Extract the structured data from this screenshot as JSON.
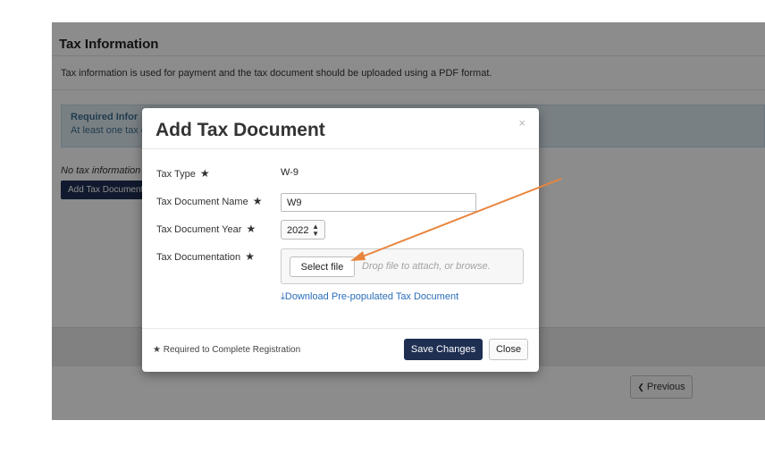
{
  "page": {
    "title": "Tax Information",
    "description": "Tax information is used for payment and the tax document should be uploaded using a PDF format.",
    "alert_title": "Required Infor",
    "alert_text": "At least one tax d",
    "no_tax_text": "No tax information",
    "add_tax_button": "Add Tax Document",
    "previous_button": "Previous",
    "previous_icon": "chevron-left-icon"
  },
  "modal": {
    "title": "Add Tax Document",
    "close_glyph": "×",
    "required_mark": "★",
    "fields": {
      "tax_type_label": "Tax Type",
      "tax_type_value": "W-9",
      "doc_name_label": "Tax Document Name",
      "doc_name_value": "W9",
      "doc_year_label": "Tax Document Year",
      "doc_year_value": "2022",
      "doc_label": "Tax Documentation"
    },
    "select_file_button": "Select file",
    "drop_hint": "Drop file to attach, or browse.",
    "download_link": "Download Pre-populated Tax Document",
    "download_icon": "download-icon",
    "footer_note": "Required to Complete Registration",
    "save_button": "Save Changes",
    "close_button": "Close"
  },
  "colors": {
    "primary_button": "#1e2f52",
    "link": "#2a6ebb",
    "annotation_arrow": "#e8843c"
  }
}
